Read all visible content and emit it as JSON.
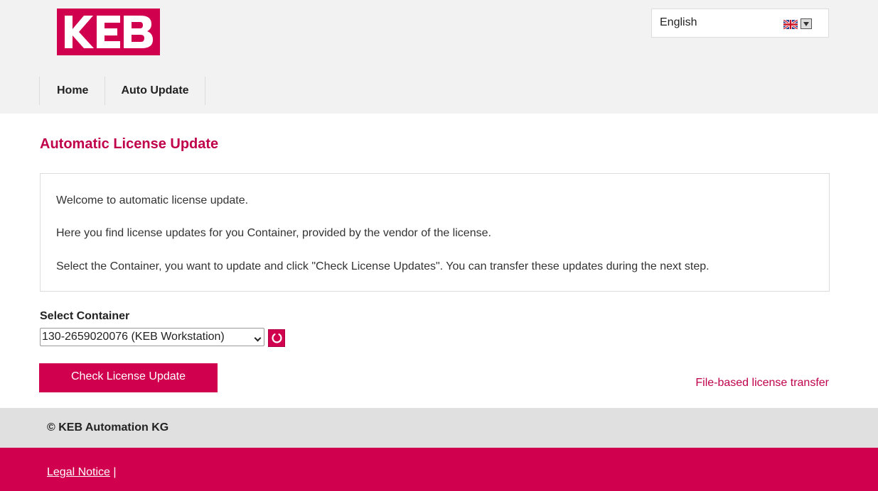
{
  "header": {
    "logo_text": "KEB",
    "language": {
      "selected": "English",
      "flag_icon": "uk-flag-icon"
    }
  },
  "nav": {
    "items": [
      {
        "label": "Home"
      },
      {
        "label": "Auto Update"
      }
    ]
  },
  "main": {
    "title": "Automatic License Update",
    "intro": [
      "Welcome to automatic license update.",
      "Here you find license updates for you Container, provided by the vendor of the license.",
      "Select the Container, you want to update and click \"Check License Updates\". You can transfer these updates during the next step."
    ],
    "select_label": "Select Container",
    "select_value": "130-2659020076 (KEB Workstation)",
    "refresh_icon": "refresh-icon",
    "check_button": "Check License Update",
    "file_link": "File-based license transfer"
  },
  "footer": {
    "copyright": "© KEB Automation KG",
    "legal_link": "Legal Notice",
    "separator": " |"
  },
  "colors": {
    "brand": "#d0004f",
    "header_bg": "#f2f2f2",
    "footer_bg": "#e0e0e0"
  }
}
